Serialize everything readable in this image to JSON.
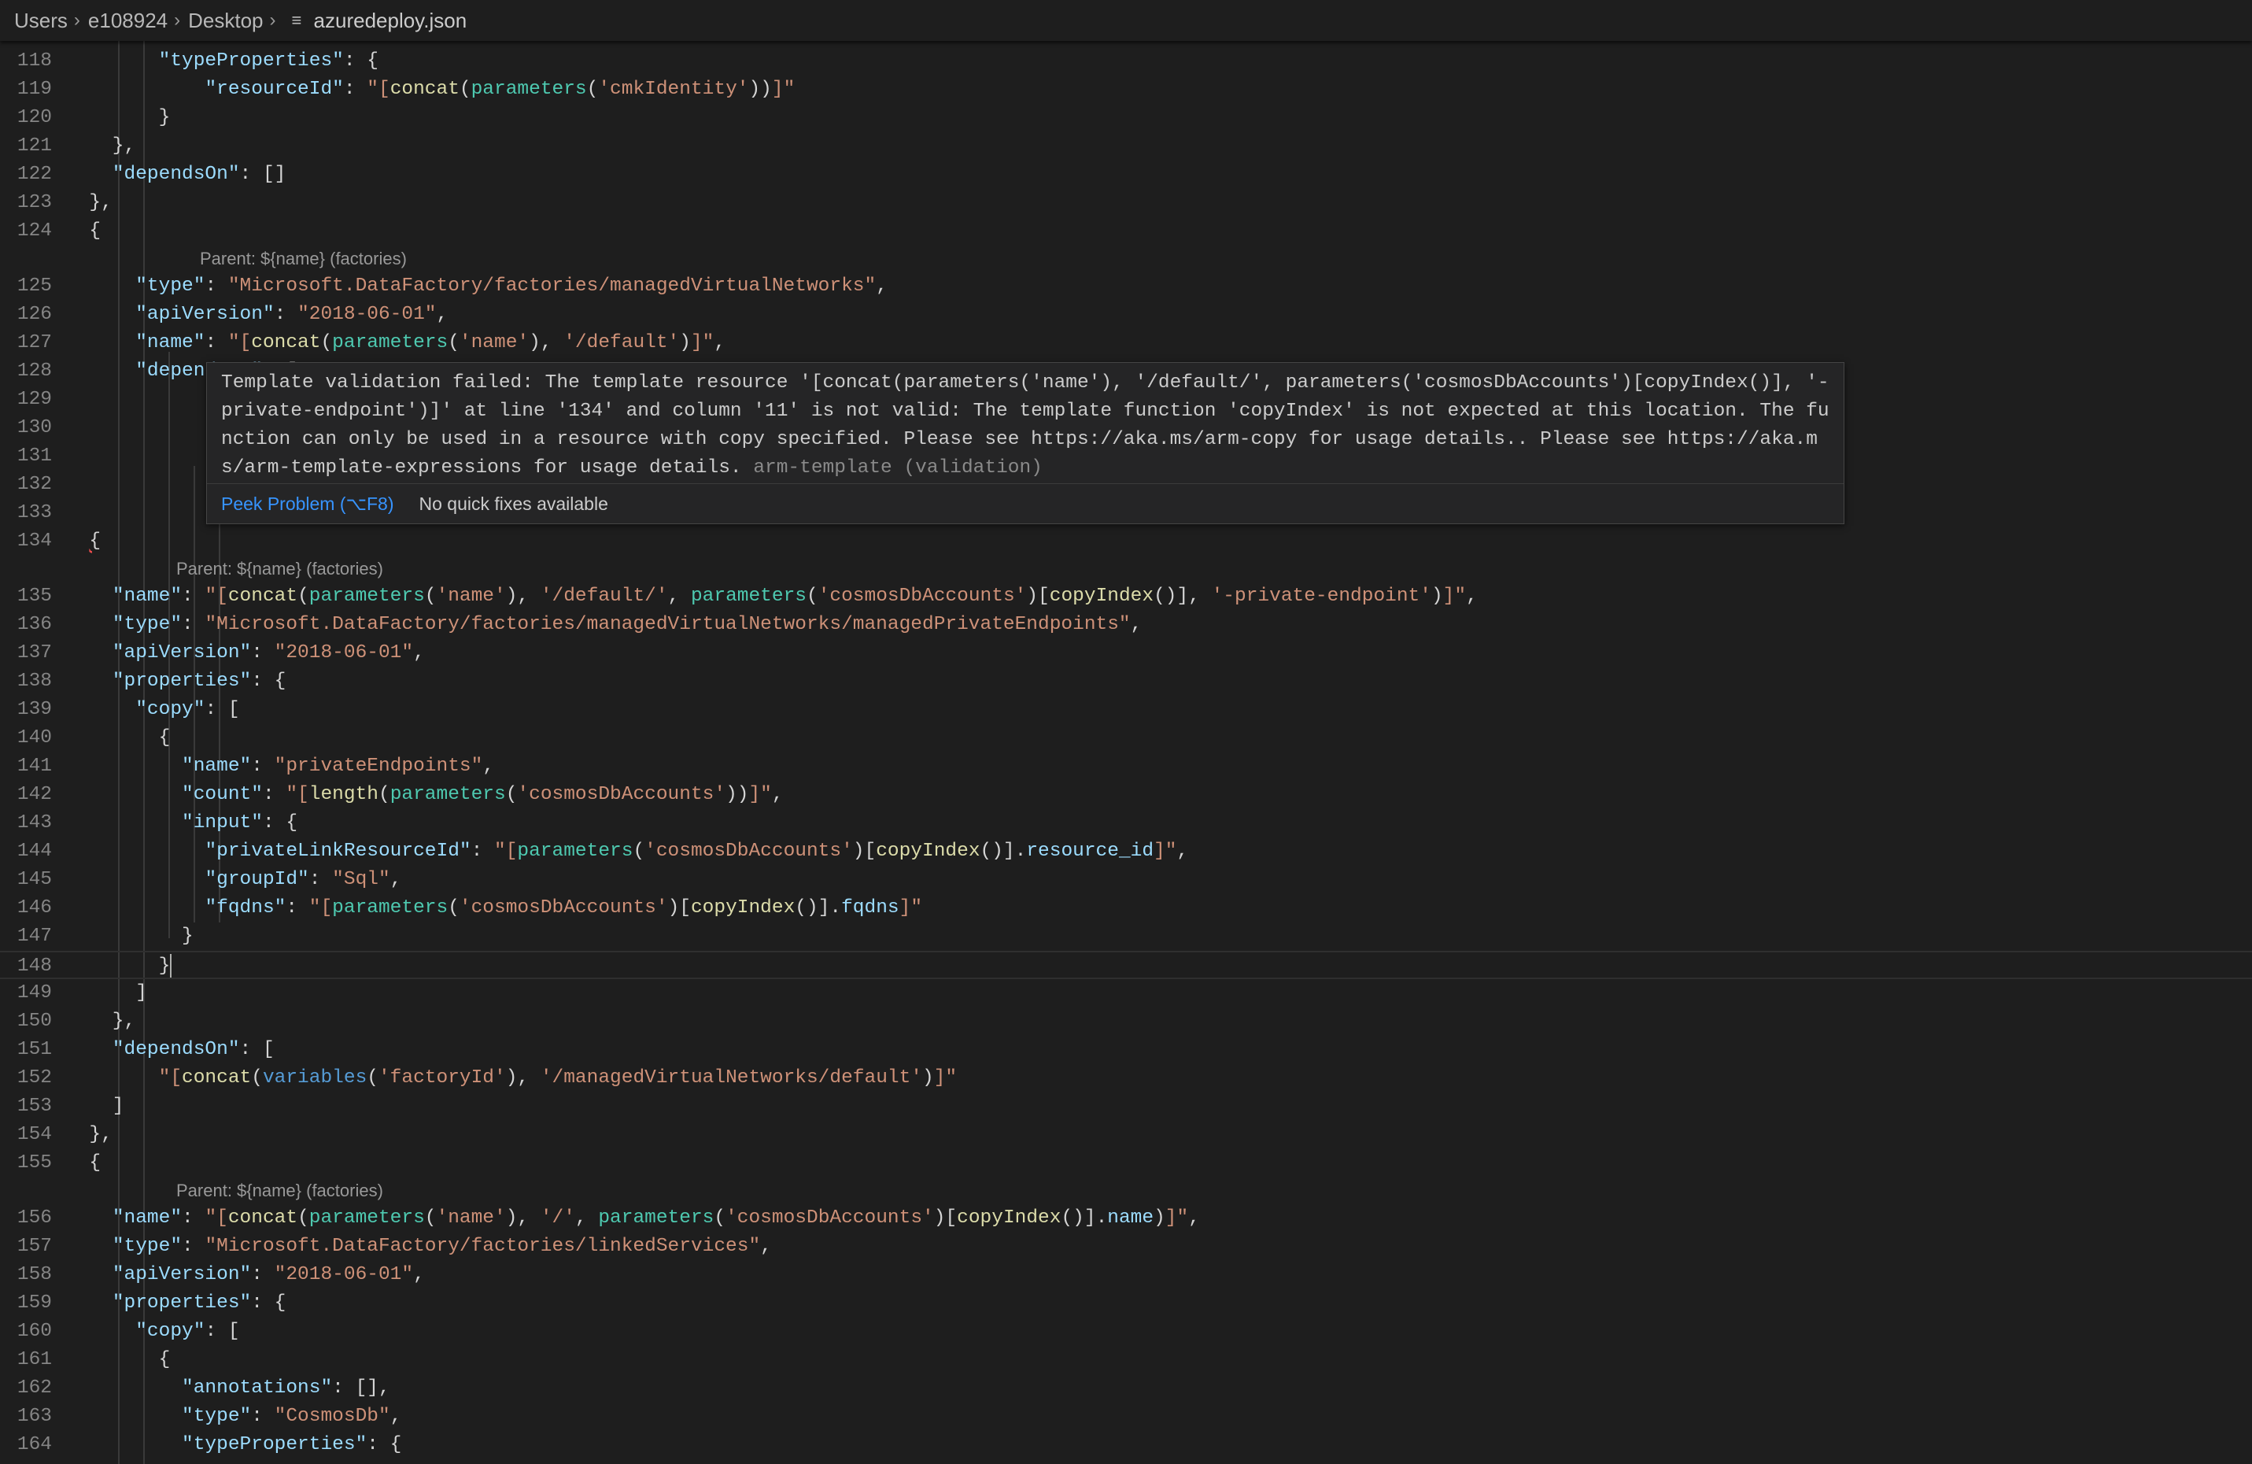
{
  "breadcrumb": {
    "items": [
      "Users",
      "e108924",
      "Desktop"
    ],
    "file": "azuredeploy.json",
    "file_icon": "json-file-icon"
  },
  "code_lens": {
    "parent_label": "Parent: ${name} (factories)"
  },
  "hover": {
    "message": "Template validation failed: The template resource '[concat(parameters('name'), '/default/', parameters('cosmosDbAccounts')[copyIndex()], '-private-endpoint')]' at line '134' and column '11' is not valid: The template function 'copyIndex' is not expected at this location. The function can only be used in a resource with copy specified. Please see https://aka.ms/arm-copy for usage details.. Please see https://aka.ms/arm-template-expressions for usage details.",
    "source": "arm-template (validation)",
    "peek_label": "Peek Problem (⌥F8)",
    "no_fix_label": "No quick fixes available"
  },
  "line_numbers": [
    118,
    119,
    120,
    121,
    122,
    123,
    124,
    125,
    126,
    127,
    128,
    129,
    130,
    131,
    132,
    133,
    134,
    135,
    136,
    137,
    138,
    139,
    140,
    141,
    142,
    143,
    144,
    145,
    146,
    147,
    148,
    149,
    150,
    151,
    152,
    153,
    154,
    155,
    156,
    157,
    158,
    159,
    160,
    161,
    162,
    163,
    164
  ],
  "code": {
    "118": [
      [
        "pn",
        "        "
      ],
      [
        "k",
        "\"typeProperties\""
      ],
      [
        "pn",
        ": {"
      ]
    ],
    "119": [
      [
        "pn",
        "            "
      ],
      [
        "k",
        "\"resourceId\""
      ],
      [
        "pn",
        ": "
      ],
      [
        "q",
        "\"["
      ],
      [
        "f",
        "concat"
      ],
      [
        "pn",
        "("
      ],
      [
        "p",
        "parameters"
      ],
      [
        "pn",
        "("
      ],
      [
        "s",
        "'cmkIdentity'"
      ],
      [
        "pn",
        "))"
      ],
      [
        "q",
        "]\""
      ]
    ],
    "120": [
      [
        "pn",
        "        }"
      ]
    ],
    "121": [
      [
        "pn",
        "    },"
      ]
    ],
    "122": [
      [
        "pn",
        "    "
      ],
      [
        "k",
        "\"dependsOn\""
      ],
      [
        "pn",
        ": []"
      ]
    ],
    "123": [
      [
        "pn",
        "  },"
      ]
    ],
    "124": [
      [
        "pn",
        "  {"
      ]
    ],
    "125": [
      [
        "pn",
        "      "
      ],
      [
        "k",
        "\"type\""
      ],
      [
        "pn",
        ": "
      ],
      [
        "s",
        "\"Microsoft.DataFactory/factories/managedVirtualNetworks\""
      ],
      [
        "pn",
        ","
      ]
    ],
    "126": [
      [
        "pn",
        "      "
      ],
      [
        "k",
        "\"apiVersion\""
      ],
      [
        "pn",
        ": "
      ],
      [
        "s",
        "\"2018-06-01\""
      ],
      [
        "pn",
        ","
      ]
    ],
    "127": [
      [
        "pn",
        "      "
      ],
      [
        "k",
        "\"name\""
      ],
      [
        "pn",
        ": "
      ],
      [
        "q",
        "\"["
      ],
      [
        "f",
        "concat"
      ],
      [
        "pn",
        "("
      ],
      [
        "p",
        "parameters"
      ],
      [
        "pn",
        "("
      ],
      [
        "s",
        "'name'"
      ],
      [
        "pn",
        "), "
      ],
      [
        "s",
        "'/default'"
      ],
      [
        "pn",
        ")"
      ],
      [
        "q",
        "]\""
      ],
      [
        "pn",
        ","
      ]
    ],
    "128": [
      [
        "pn",
        "      "
      ],
      [
        "k",
        "\"dependsOn\""
      ],
      [
        "pn",
        ": ["
      ]
    ],
    "134": [
      [
        "pn",
        "  {"
      ]
    ],
    "135": [
      [
        "pn",
        "    "
      ],
      [
        "k",
        "\"name\""
      ],
      [
        "pn",
        ": "
      ],
      [
        "q",
        "\"["
      ],
      [
        "f",
        "concat"
      ],
      [
        "pn",
        "("
      ],
      [
        "p",
        "parameters"
      ],
      [
        "pn",
        "("
      ],
      [
        "s",
        "'name'"
      ],
      [
        "pn",
        "), "
      ],
      [
        "s",
        "'/default/'"
      ],
      [
        "pn",
        ", "
      ],
      [
        "p",
        "parameters"
      ],
      [
        "pn",
        "("
      ],
      [
        "s",
        "'cosmosDbAccounts'"
      ],
      [
        "pn",
        ")["
      ],
      [
        "f",
        "copyIndex"
      ],
      [
        "pn",
        "()], "
      ],
      [
        "s",
        "'-private-endpoint'"
      ],
      [
        "pn",
        ")"
      ],
      [
        "q",
        "]\""
      ],
      [
        "pn",
        ","
      ]
    ],
    "136": [
      [
        "pn",
        "    "
      ],
      [
        "k",
        "\"type\""
      ],
      [
        "pn",
        ": "
      ],
      [
        "s",
        "\"Microsoft.DataFactory/factories/managedVirtualNetworks/managedPrivateEndpoints\""
      ],
      [
        "pn",
        ","
      ]
    ],
    "137": [
      [
        "pn",
        "    "
      ],
      [
        "k",
        "\"apiVersion\""
      ],
      [
        "pn",
        ": "
      ],
      [
        "s",
        "\"2018-06-01\""
      ],
      [
        "pn",
        ","
      ]
    ],
    "138": [
      [
        "pn",
        "    "
      ],
      [
        "k",
        "\"properties\""
      ],
      [
        "pn",
        ": {"
      ]
    ],
    "139": [
      [
        "pn",
        "      "
      ],
      [
        "k",
        "\"copy\""
      ],
      [
        "pn",
        ": ["
      ]
    ],
    "140": [
      [
        "pn",
        "        {"
      ]
    ],
    "141": [
      [
        "pn",
        "          "
      ],
      [
        "k",
        "\"name\""
      ],
      [
        "pn",
        ": "
      ],
      [
        "s",
        "\"privateEndpoints\""
      ],
      [
        "pn",
        ","
      ]
    ],
    "142": [
      [
        "pn",
        "          "
      ],
      [
        "k",
        "\"count\""
      ],
      [
        "pn",
        ": "
      ],
      [
        "q",
        "\"["
      ],
      [
        "f",
        "length"
      ],
      [
        "pn",
        "("
      ],
      [
        "p",
        "parameters"
      ],
      [
        "pn",
        "("
      ],
      [
        "s",
        "'cosmosDbAccounts'"
      ],
      [
        "pn",
        "))"
      ],
      [
        "q",
        "]\""
      ],
      [
        "pn",
        ","
      ]
    ],
    "143": [
      [
        "pn",
        "          "
      ],
      [
        "k",
        "\"input\""
      ],
      [
        "pn",
        ": {"
      ]
    ],
    "144": [
      [
        "pn",
        "            "
      ],
      [
        "k",
        "\"privateLinkResourceId\""
      ],
      [
        "pn",
        ": "
      ],
      [
        "q",
        "\"["
      ],
      [
        "p",
        "parameters"
      ],
      [
        "pn",
        "("
      ],
      [
        "s",
        "'cosmosDbAccounts'"
      ],
      [
        "pn",
        ")["
      ],
      [
        "f",
        "copyIndex"
      ],
      [
        "pn",
        "()]."
      ],
      [
        "k",
        "resource_id"
      ],
      [
        "q",
        "]\""
      ],
      [
        "pn",
        ","
      ]
    ],
    "145": [
      [
        "pn",
        "            "
      ],
      [
        "k",
        "\"groupId\""
      ],
      [
        "pn",
        ": "
      ],
      [
        "s",
        "\"Sql\""
      ],
      [
        "pn",
        ","
      ]
    ],
    "146": [
      [
        "pn",
        "            "
      ],
      [
        "k",
        "\"fqdns\""
      ],
      [
        "pn",
        ": "
      ],
      [
        "q",
        "\"["
      ],
      [
        "p",
        "parameters"
      ],
      [
        "pn",
        "("
      ],
      [
        "s",
        "'cosmosDbAccounts'"
      ],
      [
        "pn",
        ")["
      ],
      [
        "f",
        "copyIndex"
      ],
      [
        "pn",
        "()]."
      ],
      [
        "k",
        "fqdns"
      ],
      [
        "q",
        "]\""
      ]
    ],
    "147": [
      [
        "pn",
        "          }"
      ]
    ],
    "148": [
      [
        "pn",
        "        }"
      ]
    ],
    "149": [
      [
        "pn",
        "      ]"
      ]
    ],
    "150": [
      [
        "pn",
        "    },"
      ]
    ],
    "151": [
      [
        "pn",
        "    "
      ],
      [
        "k",
        "\"dependsOn\""
      ],
      [
        "pn",
        ": ["
      ]
    ],
    "152": [
      [
        "pn",
        "        "
      ],
      [
        "q",
        "\"["
      ],
      [
        "f",
        "concat"
      ],
      [
        "pn",
        "("
      ],
      [
        "v",
        "variables"
      ],
      [
        "pn",
        "("
      ],
      [
        "s",
        "'factoryId'"
      ],
      [
        "pn",
        "), "
      ],
      [
        "s",
        "'/managedVirtualNetworks/default'"
      ],
      [
        "pn",
        ")"
      ],
      [
        "q",
        "]\""
      ]
    ],
    "153": [
      [
        "pn",
        "    ]"
      ]
    ],
    "154": [
      [
        "pn",
        "  },"
      ]
    ],
    "155": [
      [
        "pn",
        "  {"
      ]
    ],
    "156": [
      [
        "pn",
        "    "
      ],
      [
        "k",
        "\"name\""
      ],
      [
        "pn",
        ": "
      ],
      [
        "q",
        "\"["
      ],
      [
        "f",
        "concat"
      ],
      [
        "pn",
        "("
      ],
      [
        "p",
        "parameters"
      ],
      [
        "pn",
        "("
      ],
      [
        "s",
        "'name'"
      ],
      [
        "pn",
        "), "
      ],
      [
        "s",
        "'/'"
      ],
      [
        "pn",
        ", "
      ],
      [
        "p",
        "parameters"
      ],
      [
        "pn",
        "("
      ],
      [
        "s",
        "'cosmosDbAccounts'"
      ],
      [
        "pn",
        ")["
      ],
      [
        "f",
        "copyIndex"
      ],
      [
        "pn",
        "()]."
      ],
      [
        "k",
        "name"
      ],
      [
        "pn",
        ")"
      ],
      [
        "q",
        "]\""
      ],
      [
        "pn",
        ","
      ]
    ],
    "157": [
      [
        "pn",
        "    "
      ],
      [
        "k",
        "\"type\""
      ],
      [
        "pn",
        ": "
      ],
      [
        "s",
        "\"Microsoft.DataFactory/factories/linkedServices\""
      ],
      [
        "pn",
        ","
      ]
    ],
    "158": [
      [
        "pn",
        "    "
      ],
      [
        "k",
        "\"apiVersion\""
      ],
      [
        "pn",
        ": "
      ],
      [
        "s",
        "\"2018-06-01\""
      ],
      [
        "pn",
        ","
      ]
    ],
    "159": [
      [
        "pn",
        "    "
      ],
      [
        "k",
        "\"properties\""
      ],
      [
        "pn",
        ": {"
      ]
    ],
    "160": [
      [
        "pn",
        "      "
      ],
      [
        "k",
        "\"copy\""
      ],
      [
        "pn",
        ": ["
      ]
    ],
    "161": [
      [
        "pn",
        "        {"
      ]
    ],
    "162": [
      [
        "pn",
        "          "
      ],
      [
        "k",
        "\"annotations\""
      ],
      [
        "pn",
        ": [],"
      ]
    ],
    "163": [
      [
        "pn",
        "          "
      ],
      [
        "k",
        "\"type\""
      ],
      [
        "pn",
        ": "
      ],
      [
        "s",
        "\"CosmosDb\""
      ],
      [
        "pn",
        ","
      ]
    ],
    "164": [
      [
        "pn",
        "          "
      ],
      [
        "k",
        "\"typeProperties\""
      ],
      [
        "pn",
        ": {"
      ]
    ]
  },
  "colors": {
    "background": "#1e1e1e",
    "key": "#9cdcfe",
    "string": "#ce9178",
    "function": "#dcdcaa",
    "parameters_fn": "#4ec9b0",
    "variables_fn": "#569cd6",
    "line_number": "#858585",
    "link": "#3794ff",
    "error": "#f14c4c"
  }
}
